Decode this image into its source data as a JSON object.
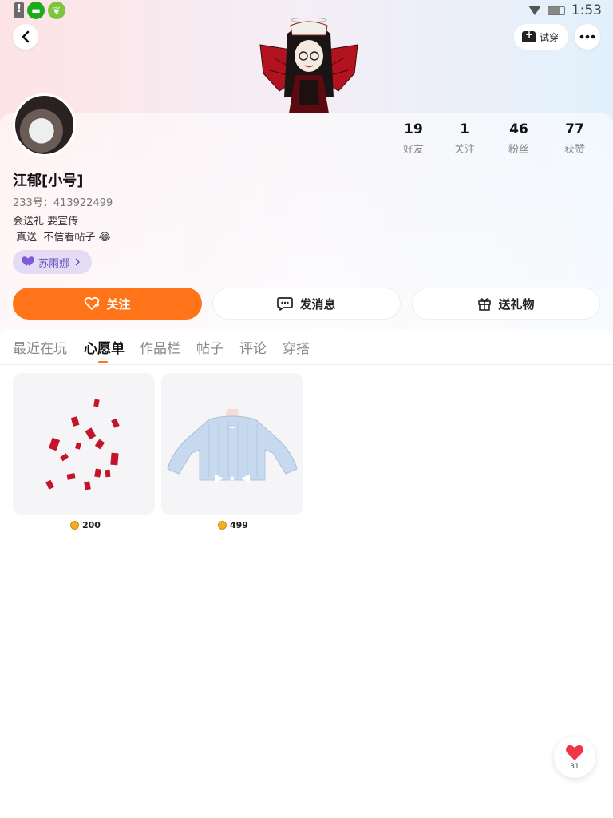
{
  "status_bar": {
    "time": "1:53"
  },
  "header": {
    "try_on_label": "试穿"
  },
  "profile": {
    "username": "江郁[小号]",
    "uid_text": "233号：413922499",
    "bio": "会送礼 要宣传\n 真送  不信看帖子 😂",
    "close_friend": {
      "name": "苏雨娜"
    }
  },
  "stats": [
    {
      "value": "19",
      "label": "好友"
    },
    {
      "value": "1",
      "label": "关注"
    },
    {
      "value": "46",
      "label": "粉丝"
    },
    {
      "value": "77",
      "label": "获赞"
    }
  ],
  "actions": {
    "follow": "关注",
    "message": "发消息",
    "gift": "送礼物"
  },
  "tabs": [
    {
      "label": "最近在玩",
      "active": false
    },
    {
      "label": "心愿单",
      "active": true
    },
    {
      "label": "作品栏",
      "active": false
    },
    {
      "label": "帖子",
      "active": false
    },
    {
      "label": "评论",
      "active": false
    },
    {
      "label": "穿搭",
      "active": false
    }
  ],
  "wishlist": [
    {
      "item": "red-envelopes",
      "price": "200"
    },
    {
      "item": "blue-sweater",
      "price": "499"
    }
  ],
  "floating_like": {
    "count": "31"
  },
  "colors": {
    "accent": "#ff7319",
    "purple_tag": "#6b4fc0",
    "coin": "#f2b01e"
  }
}
